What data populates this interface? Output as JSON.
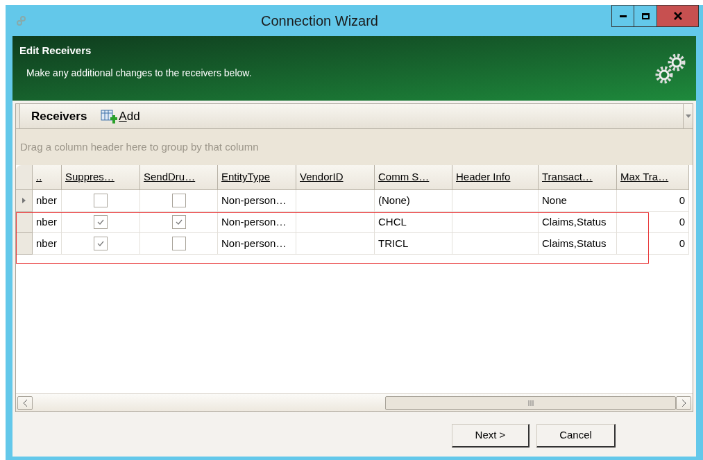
{
  "window": {
    "title": "Connection Wizard"
  },
  "header": {
    "title": "Edit Receivers",
    "subtitle": "Make any additional changes to the receivers below."
  },
  "toolbar": {
    "title": "Receivers",
    "add_label": "Add"
  },
  "group_hint": "Drag a column header here to group by that column",
  "columns": [
    {
      "label": "..",
      "kind": "text"
    },
    {
      "label": "Suppres…",
      "kind": "check"
    },
    {
      "label": "SendDru…",
      "kind": "check"
    },
    {
      "label": "EntityType",
      "kind": "text"
    },
    {
      "label": "VendorID",
      "kind": "text"
    },
    {
      "label": "Comm S…",
      "kind": "text"
    },
    {
      "label": "Header Info",
      "kind": "text"
    },
    {
      "label": "Transact…",
      "kind": "text"
    },
    {
      "label": "Max Tra…",
      "kind": "number"
    }
  ],
  "rows": [
    {
      "current": true,
      "cells": [
        {
          "text": "nber"
        },
        {
          "checked": false
        },
        {
          "checked": false
        },
        {
          "text": "Non-person…"
        },
        {
          "text": ""
        },
        {
          "text": "(None)"
        },
        {
          "text": ""
        },
        {
          "text": "None"
        },
        {
          "text": "0"
        }
      ]
    },
    {
      "current": false,
      "cells": [
        {
          "text": "nber"
        },
        {
          "checked": true
        },
        {
          "checked": true
        },
        {
          "text": "Non-person…"
        },
        {
          "text": ""
        },
        {
          "text": "CHCL"
        },
        {
          "text": ""
        },
        {
          "text": "Claims,Status"
        },
        {
          "text": "0"
        }
      ]
    },
    {
      "current": false,
      "cells": [
        {
          "text": "nber"
        },
        {
          "checked": true
        },
        {
          "checked": false
        },
        {
          "text": "Non-person…"
        },
        {
          "text": ""
        },
        {
          "text": "TRICL"
        },
        {
          "text": ""
        },
        {
          "text": "Claims,Status"
        },
        {
          "text": "0"
        }
      ]
    }
  ],
  "buttons": [
    "Next >",
    "Cancel"
  ]
}
